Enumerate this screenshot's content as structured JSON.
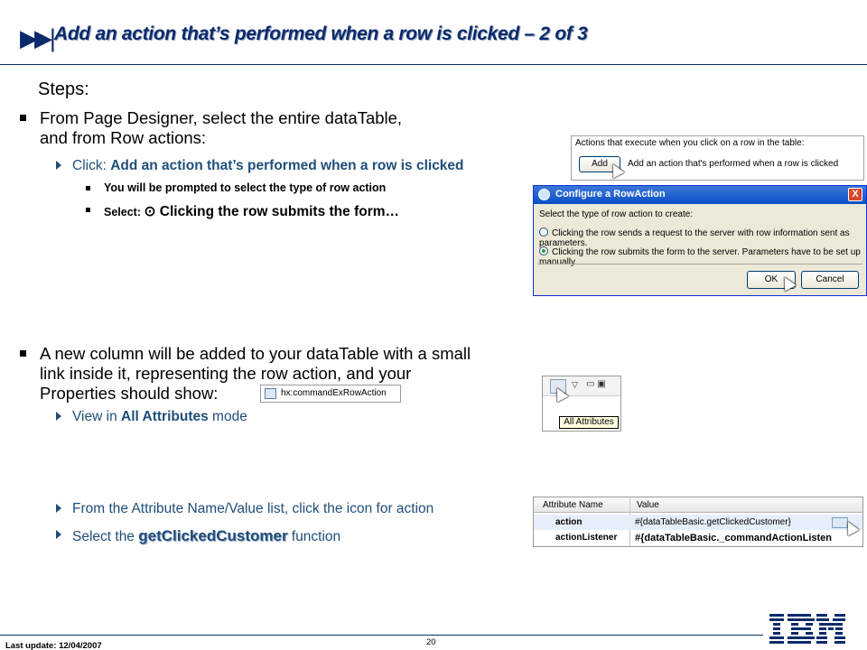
{
  "title": {
    "icon": "skip-forward-icon",
    "text": "Add an action that’s performed when a row is clicked – 2 of 3"
  },
  "steps_label": "Steps:",
  "bullet1": {
    "line1": "From Page Designer, select the entire dataTable,",
    "line2": "and from Row actions:",
    "sub1_prefix": "Click: ",
    "sub1_bold": "Add an action that’s performed when a row is clicked",
    "subsub1": "You will be prompted to select the type of row action",
    "subsub2_prefix": "Select: ",
    "subsub2_text": "⊙ Clicking the row submits the form…"
  },
  "bullet2": {
    "line1": "A new column will be added to your dataTable with a small",
    "line2": "link inside it, representing the row action, and your",
    "line3": "Properties should show:",
    "sub1_prefix": "View in ",
    "sub1_bold": "All Attributes",
    "sub1_suffix": " mode",
    "sub2": "From the Attribute Name/Value list, click the icon for action",
    "sub3_prefix": "Select the ",
    "sub3_bold": "getClickedCustomer",
    "sub3_suffix": " function"
  },
  "shot_actions": {
    "caption": "Actions that execute when you click on a row in the table:",
    "add_button": "Add",
    "add_label": "Add an action that's performed when a row is clicked"
  },
  "dialog": {
    "title": "Configure a RowAction",
    "close": "X",
    "question": "Select the type of row action to create:",
    "option1": "Clicking the row sends a request to the server with row information sent as parameters.",
    "option2": "Clicking the row submits the form to the server. Parameters have to be set up manually.",
    "selected_option": 2,
    "ok": "OK",
    "cancel": "Cancel"
  },
  "props_tag": "hx:commandExRowAction",
  "attr_panel": {
    "tooltip": "All Attributes"
  },
  "attr_table": {
    "col_name": "Attribute Name",
    "col_value": "Value",
    "rows": [
      {
        "name": "action",
        "value": "#{dataTableBasic.getClickedCustomer}"
      },
      {
        "name": "actionListener",
        "value": "#{dataTableBasic._commandActionListen"
      }
    ]
  },
  "footer": {
    "last_update": "Last update: 12/04/2007",
    "page": "20"
  },
  "colors": {
    "title": "#0b2a6b",
    "sub_text": "#1f4e79"
  }
}
